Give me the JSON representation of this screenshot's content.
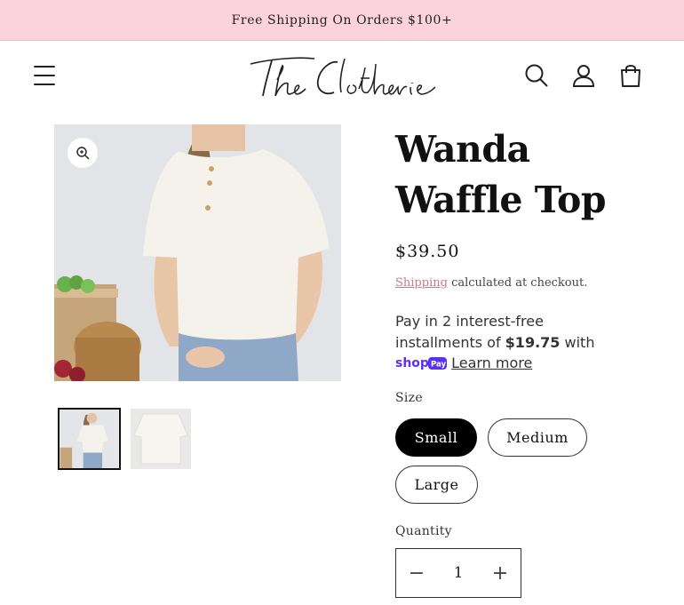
{
  "announcement": {
    "text": "Free Shipping On Orders $100+"
  },
  "header": {
    "logo_text": "The Clotherie"
  },
  "product": {
    "title": "Wanda Waffle Top",
    "price": "$39.50",
    "shipping_link": "Shipping",
    "shipping_note": "calculated at checkout.",
    "shoppay": {
      "line1": "Pay in 2 interest-free",
      "line2_prefix": "installments of",
      "amount": "$19.75",
      "line2_suffix": "with",
      "learn_more": "Learn more"
    },
    "size": {
      "label": "Size",
      "options": [
        "Small",
        "Medium",
        "Large"
      ],
      "selected": "Small"
    },
    "quantity": {
      "label": "Quantity",
      "value": "1"
    }
  },
  "colors": {
    "announcement_bg": "#fcd3dc",
    "link": "#c97b8a",
    "shoppay": "#5a31f4"
  }
}
